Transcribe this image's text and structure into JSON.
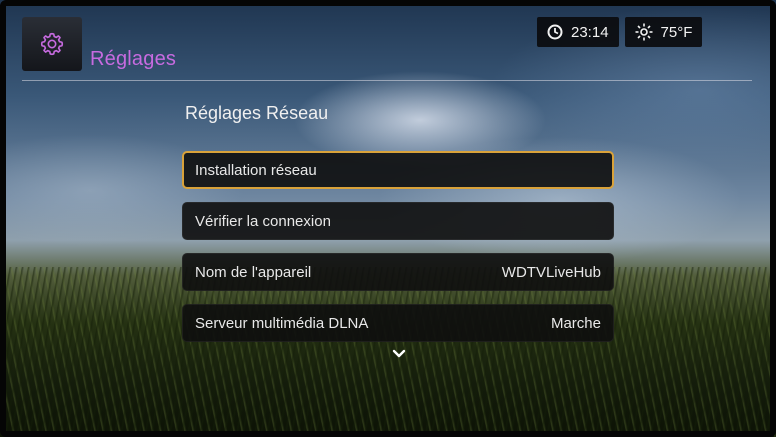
{
  "header": {
    "title": "Réglages",
    "icon": "gear-icon",
    "accent_color": "#c76be0"
  },
  "status": {
    "time": "23:14",
    "time_icon": "clock-icon",
    "temperature": "75°F",
    "weather_icon": "sun-icon"
  },
  "section": {
    "title": "Réglages Réseau"
  },
  "menu": {
    "items": [
      {
        "label": "Installation réseau",
        "value": ""
      },
      {
        "label": "Vérifier la connexion",
        "value": ""
      },
      {
        "label": "Nom de l'appareil",
        "value": "WDTVLiveHub"
      },
      {
        "label": "Serveur multimédia DLNA",
        "value": "Marche"
      }
    ],
    "selected_index": 0,
    "selection_color": "#d9a23a",
    "more_icon": "chevron-down-icon"
  }
}
